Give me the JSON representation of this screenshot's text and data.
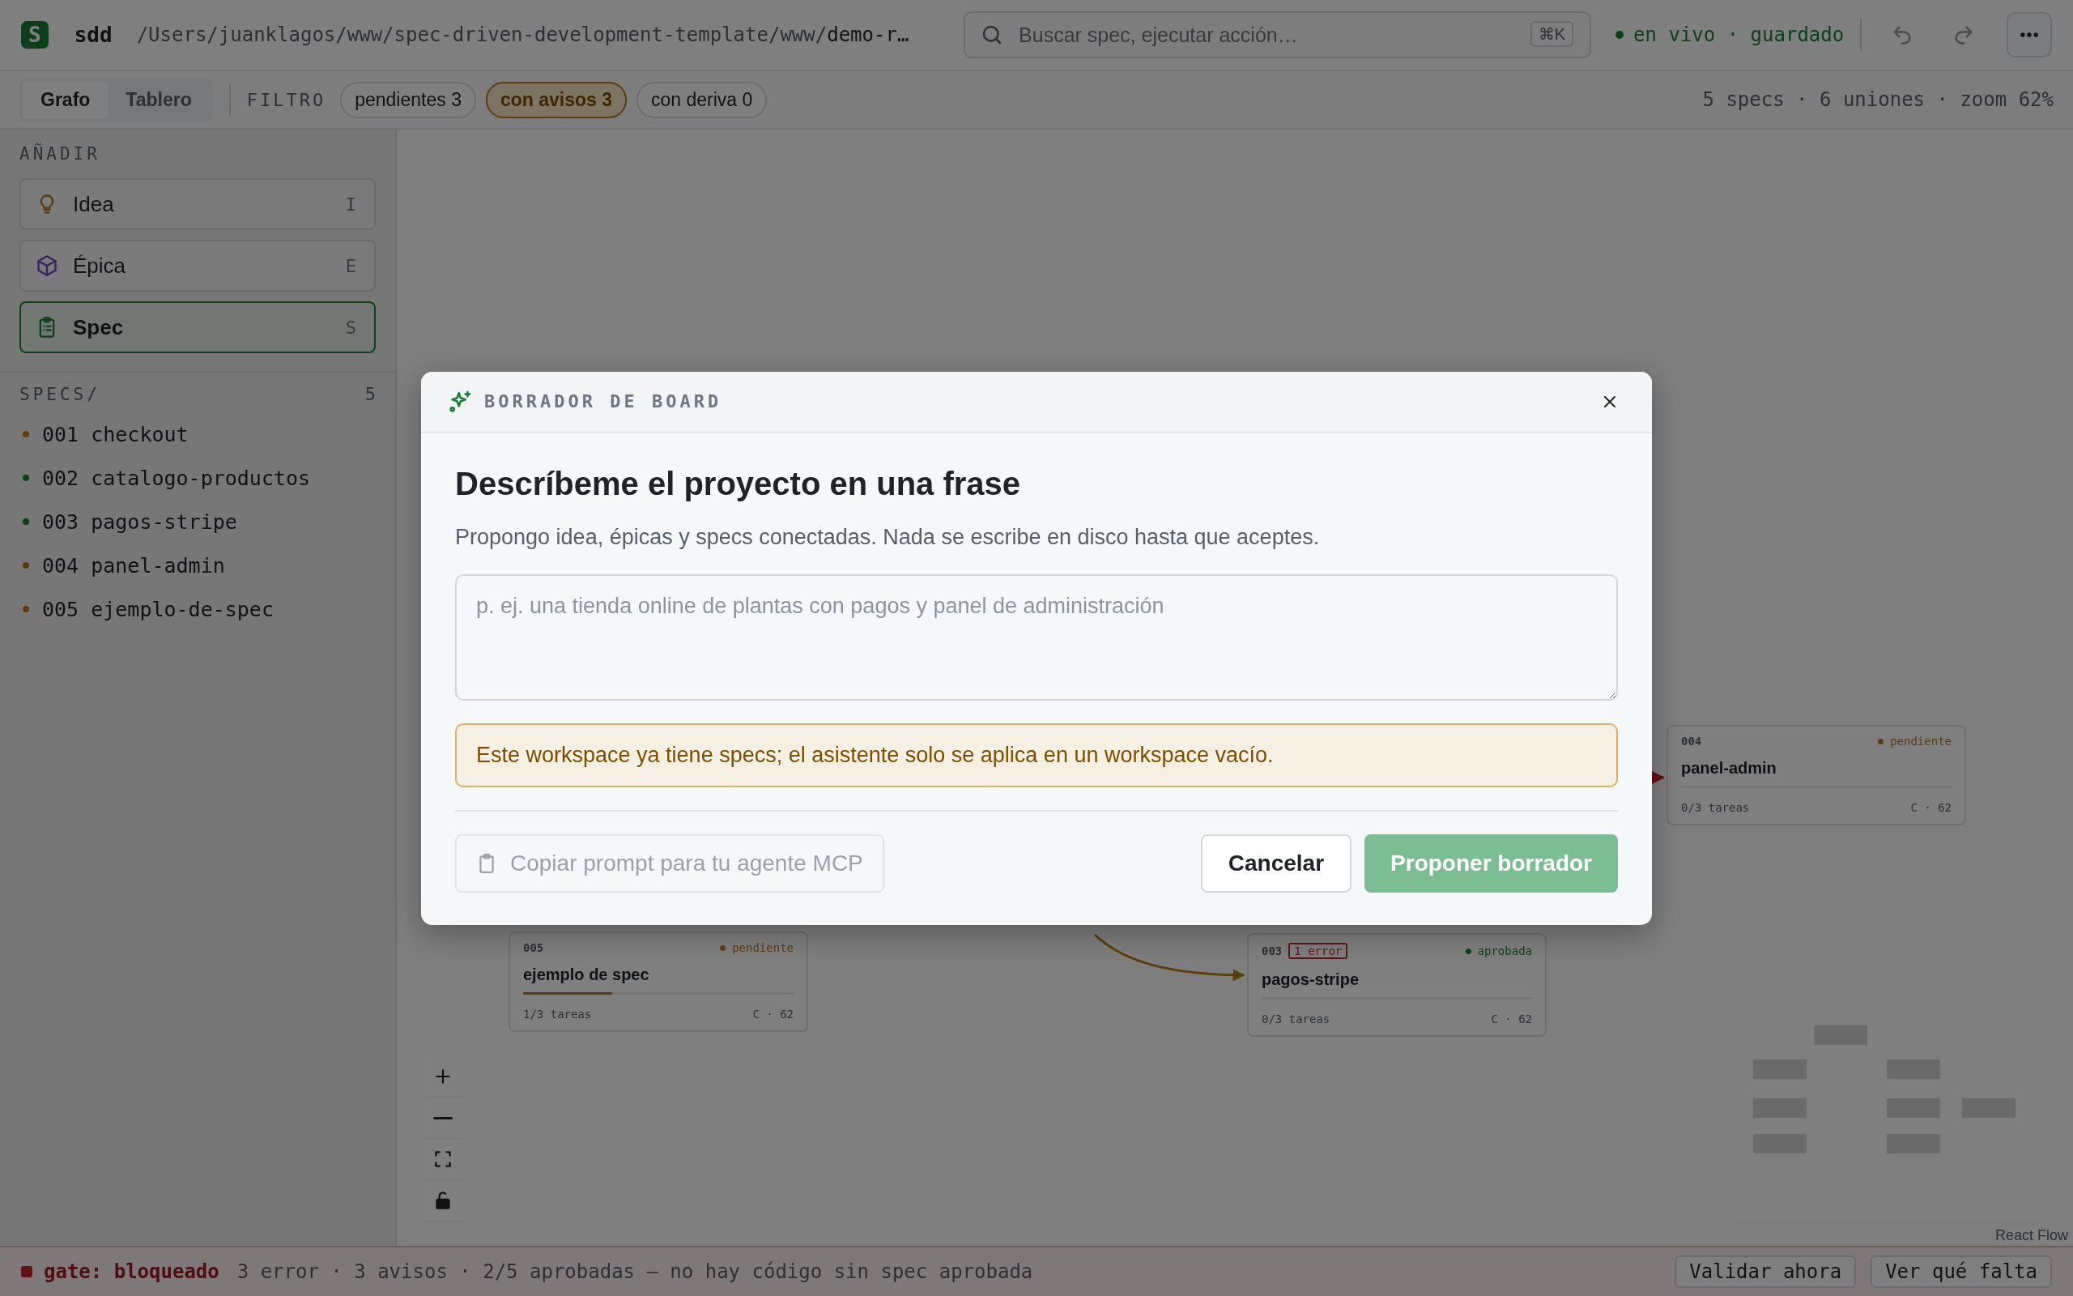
{
  "header": {
    "logo": "S",
    "app": "sdd",
    "path_prefix": "/Users/juanklagos/www/spec-driven-development-template/www/",
    "path_current": "demo-r…",
    "search": {
      "placeholder": "Buscar spec, ejecutar acción…",
      "shortcut": "⌘K"
    },
    "sync": {
      "text": "en vivo · guardado",
      "color": "#0d3f1b"
    }
  },
  "toolbar": {
    "views": [
      {
        "label": "Grafo",
        "selected": true
      },
      {
        "label": "Tablero",
        "selected": false
      }
    ],
    "filter_label": "FILTRO",
    "filters": [
      {
        "label": "pendientes 3",
        "selected": false
      },
      {
        "label": "con avisos 3",
        "selected": true
      },
      {
        "label": "con deriva 0",
        "selected": false
      }
    ],
    "stats": "5 specs · 6 uniones · zoom 62%"
  },
  "sidebar": {
    "add_title": "AÑADIR",
    "add_items": [
      {
        "kind": "idea",
        "label": "Idea",
        "key": "I",
        "selected": false
      },
      {
        "kind": "epic",
        "label": "Épica",
        "key": "E",
        "selected": false
      },
      {
        "kind": "spec",
        "label": "Spec",
        "key": "S",
        "selected": true
      }
    ],
    "specs_title": "SPECS/",
    "specs_count": "5",
    "specs": [
      {
        "label": "001 checkout",
        "color": "#5b3c0f"
      },
      {
        "label": "002 catalogo-productos",
        "color": "#0d3f1b"
      },
      {
        "label": "003 pagos-stripe",
        "color": "#0d3f1b"
      },
      {
        "label": "004 panel-admin",
        "color": "#5b3c0f"
      },
      {
        "label": "005 ejemplo-de-spec",
        "color": "#5b3c0f"
      }
    ]
  },
  "canvas": {
    "nodes": [
      {
        "id": "005",
        "title": "ejemplo de spec",
        "status": "pendiente",
        "color": "#5b3c0f",
        "tasks": "1/3 tareas",
        "meta": "C · 62",
        "level": 0.33
      },
      {
        "id": "003",
        "badge": "1 error",
        "title": "pagos-stripe",
        "status": "aprobada",
        "color": "#0d3f1b",
        "tasks": "0/3 tareas",
        "meta": "C · 62"
      },
      {
        "id": "004",
        "title": "panel-admin",
        "status": "pendiente",
        "color": "#5b3c0f",
        "tasks": "0/3 tareas",
        "meta": "C · 62"
      }
    ],
    "attribution": "React Flow"
  },
  "modal": {
    "title": "BORRADOR DE BOARD",
    "heading": "Descríbeme el proyecto en una frase",
    "description": "Propongo idea, épicas y specs conectadas. Nada se escribe en disco hasta que aceptes.",
    "input": {
      "placeholder": "p. ej. una tienda online de plantas con pagos y panel de administración"
    },
    "warning": "Este workspace ya tiene specs; el asistente solo se aplica en un workspace vacío.",
    "buttons": [
      {
        "kind": "copy",
        "label": "Copiar prompt para tu agente MCP",
        "disabled": true
      },
      {
        "kind": "cancel",
        "label": "Cancelar",
        "disabled": false
      },
      {
        "kind": "primary",
        "label": "Proponer borrador",
        "disabled": true
      }
    ]
  },
  "status_bar": {
    "gate": "gate: bloqueado",
    "summary": "3 error · 3 avisos · 2/5 aprobadas — no hay código sin spec aprobada",
    "actions": [
      "Validar ahora",
      "Ver qué falta"
    ]
  }
}
